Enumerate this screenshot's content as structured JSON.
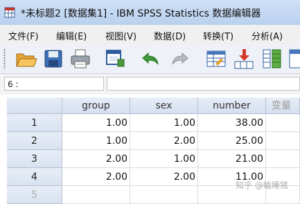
{
  "window": {
    "title": "*未标题2 [数据集1] - IBM SPSS Statistics 数据编辑器"
  },
  "menu": [
    {
      "label": "文件(F)"
    },
    {
      "label": "编辑(E)"
    },
    {
      "label": "视图(V)"
    },
    {
      "label": "数据(D)"
    },
    {
      "label": "转换(T)"
    },
    {
      "label": "分析(A)"
    }
  ],
  "toolbar": {
    "icons": [
      "open-folder-icon",
      "save-icon",
      "print-icon",
      "recall-dialog-icon",
      "undo-icon",
      "redo-icon",
      "goto-case-icon",
      "goto-variable-icon",
      "variables-icon"
    ]
  },
  "cell_reference": "6 :",
  "grid": {
    "columns": [
      "group",
      "sex",
      "number",
      "变量"
    ],
    "rows": [
      {
        "label": "1",
        "values": [
          "1.00",
          "1.00",
          "38.00"
        ]
      },
      {
        "label": "2",
        "values": [
          "1.00",
          "2.00",
          "25.00"
        ]
      },
      {
        "label": "3",
        "values": [
          "2.00",
          "1.00",
          "21.00"
        ]
      },
      {
        "label": "4",
        "values": [
          "2.00",
          "2.00",
          "11.00"
        ]
      },
      {
        "label": "5",
        "values": [
          "",
          "",
          ""
        ]
      }
    ]
  },
  "watermark": "知乎 @瞌睡猪"
}
